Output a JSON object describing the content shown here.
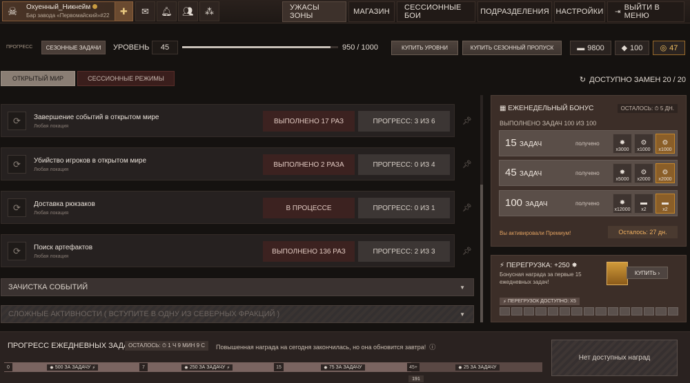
{
  "profile": {
    "nickname": "Охуенный_Никнейм",
    "guild": "Бар завода «Первомайский»#22"
  },
  "nav": {
    "items": [
      {
        "label": "УЖАСЫ ЗОНЫ",
        "active": true
      },
      {
        "label": "МАГАЗИН"
      },
      {
        "label": "СЕССИОННЫЕ БОИ"
      },
      {
        "label": "ПОДРАЗДЕЛЕНИЯ"
      },
      {
        "label": "НАСТРОЙКИ"
      },
      {
        "label": "ВЫЙТИ В МЕНЮ"
      }
    ]
  },
  "progress": {
    "label": "ПРОГРЕСС",
    "tab": "СЕЗОННЫЕ ЗАДАЧИ",
    "level_label": "УРОВЕНЬ",
    "level": "45",
    "xp_text": "950 / 1000",
    "xp_fraction": 0.95,
    "buy_levels": "КУПИТЬ УРОВНИ",
    "buy_pass": "КУПИТЬ СЕЗОННЫЙ ПРОПУСК"
  },
  "currencies": [
    {
      "icon": "ammo-icon",
      "value": "9800"
    },
    {
      "icon": "ticket-icon",
      "value": "100"
    },
    {
      "icon": "coin-icon",
      "value": "47"
    }
  ],
  "modes": {
    "open_world": "ОТКРЫТЫЙ МИР",
    "session": "СЕССИОННЫЕ РЕЖИМЫ"
  },
  "replacements": "ДОСТУПНО ЗАМЕН 20 / 20",
  "tasks": [
    {
      "title": "Завершение событий в открытом мире",
      "sub": "Любая локация",
      "status": "ВЫПОЛНЕНО 17 РАЗ",
      "progress": "ПРОГРЕСС: 3 ИЗ 6"
    },
    {
      "title": "Убийство игроков в открытом мире",
      "sub": "Любая локация",
      "status": "ВЫПОЛНЕНО 2 РАЗА",
      "progress": "ПРОГРЕСС: 0 ИЗ 4"
    },
    {
      "title": "Доставка рюкзаков",
      "sub": "Любая локация",
      "status": "В ПРОЦЕССЕ",
      "progress": "ПРОГРЕСС: 0 ИЗ 1"
    },
    {
      "title": "Поиск артефактов",
      "sub": "Любая локация",
      "status": "ВЫПОЛНЕНО 136 РАЗ",
      "progress": "ПРОГРЕСС: 2 ИЗ 3"
    }
  ],
  "sections": {
    "events_clear": "ЗАЧИСТКА СОБЫТИЙ",
    "hard_activities": "СЛОЖНЫЕ АКТИВНОСТИ ( ВСТУПИТЕ В ОДНУ ИЗ СЕВЕРНЫХ ФРАКЦИЙ )"
  },
  "weekly": {
    "title": "ЕЖЕНЕДЕЛЬНЫЙ БОНУС",
    "left": "ОСТАЛОСЬ: ⏱ 5 ДН.",
    "done": "ВЫПОЛНЕНО ЗАДАЧ 100 ИЗ 100",
    "tiers": [
      {
        "count": "15",
        "unit": "ЗАДАЧ",
        "state": "получено",
        "rewards": [
          "x3000",
          "x1000",
          "x1000"
        ]
      },
      {
        "count": "45",
        "unit": "ЗАДАЧ",
        "state": "получено",
        "rewards": [
          "x5000",
          "x2000",
          "x2000"
        ]
      },
      {
        "count": "100",
        "unit": "ЗАДАЧ",
        "state": "получено",
        "rewards": [
          "x12000",
          "x2",
          "x2"
        ]
      }
    ],
    "premium_note": "Вы активировали Премиум!",
    "premium_left": "Осталось: 27 дн."
  },
  "overload": {
    "title": "ПЕРЕГРУЗКА: +250",
    "desc": "Бонусная награда за первые 15 ежедневных задач!",
    "buy": "КУПИТЬ",
    "available": "ПЕРЕГРУЗОК ДОСТУПНО: x5",
    "filled": 0,
    "total": 15
  },
  "daily": {
    "title": "ПРОГРЕСС ЕЖЕДНЕВНЫХ ЗАДАЧ",
    "left": "ОСТАЛОСЬ: ⏱ 1 Ч 9 МИН 9 С",
    "note": "Повышенная награда на сегодня закончилась, но она обновится завтра!",
    "ticks": [
      "0",
      "7",
      "15",
      "45+"
    ],
    "segments": [
      "500 ЗА ЗАДАЧУ",
      "250 ЗА ЗАДАЧУ",
      "75 ЗА ЗАДАЧУ",
      "25 ЗА ЗАДАЧУ"
    ],
    "current": "191",
    "no_rewards": "Нет доступных наград"
  }
}
